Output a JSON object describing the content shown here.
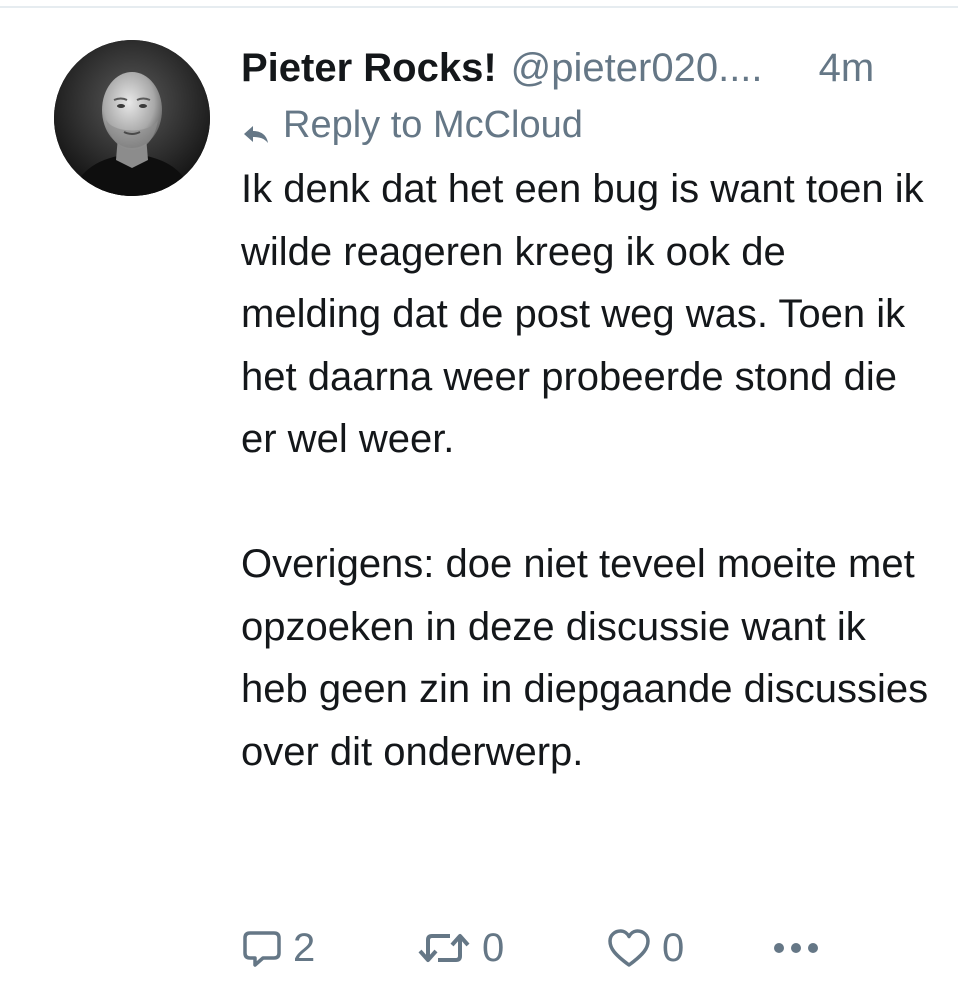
{
  "post": {
    "display_name": "Pieter Rocks!",
    "handle": "@pieter020....",
    "timestamp": "4m",
    "reply_to": "Reply to McCloud",
    "paragraphs": [
      "Ik denk dat het een bug is want toen ik wilde reageren kreeg ik ook de melding dat de post weg was. Toen ik het daarna weer probeerde stond die er wel weer.",
      "Overigens: doe niet teveel moeite met opzoeken in deze discussie want ik heb geen zin in diepgaande discussies over dit onderwerp."
    ]
  },
  "actions": {
    "reply_count": "2",
    "reblog_count": "0",
    "like_count": "0"
  },
  "icons": {
    "reply": "reply-arrow-icon",
    "comment": "speech-bubble-icon",
    "reblog": "retweet-icon",
    "like": "heart-icon",
    "more": "more-dots-icon"
  },
  "colors": {
    "text": "#14171a",
    "muted": "#657786",
    "divider": "#e6ecf0"
  }
}
